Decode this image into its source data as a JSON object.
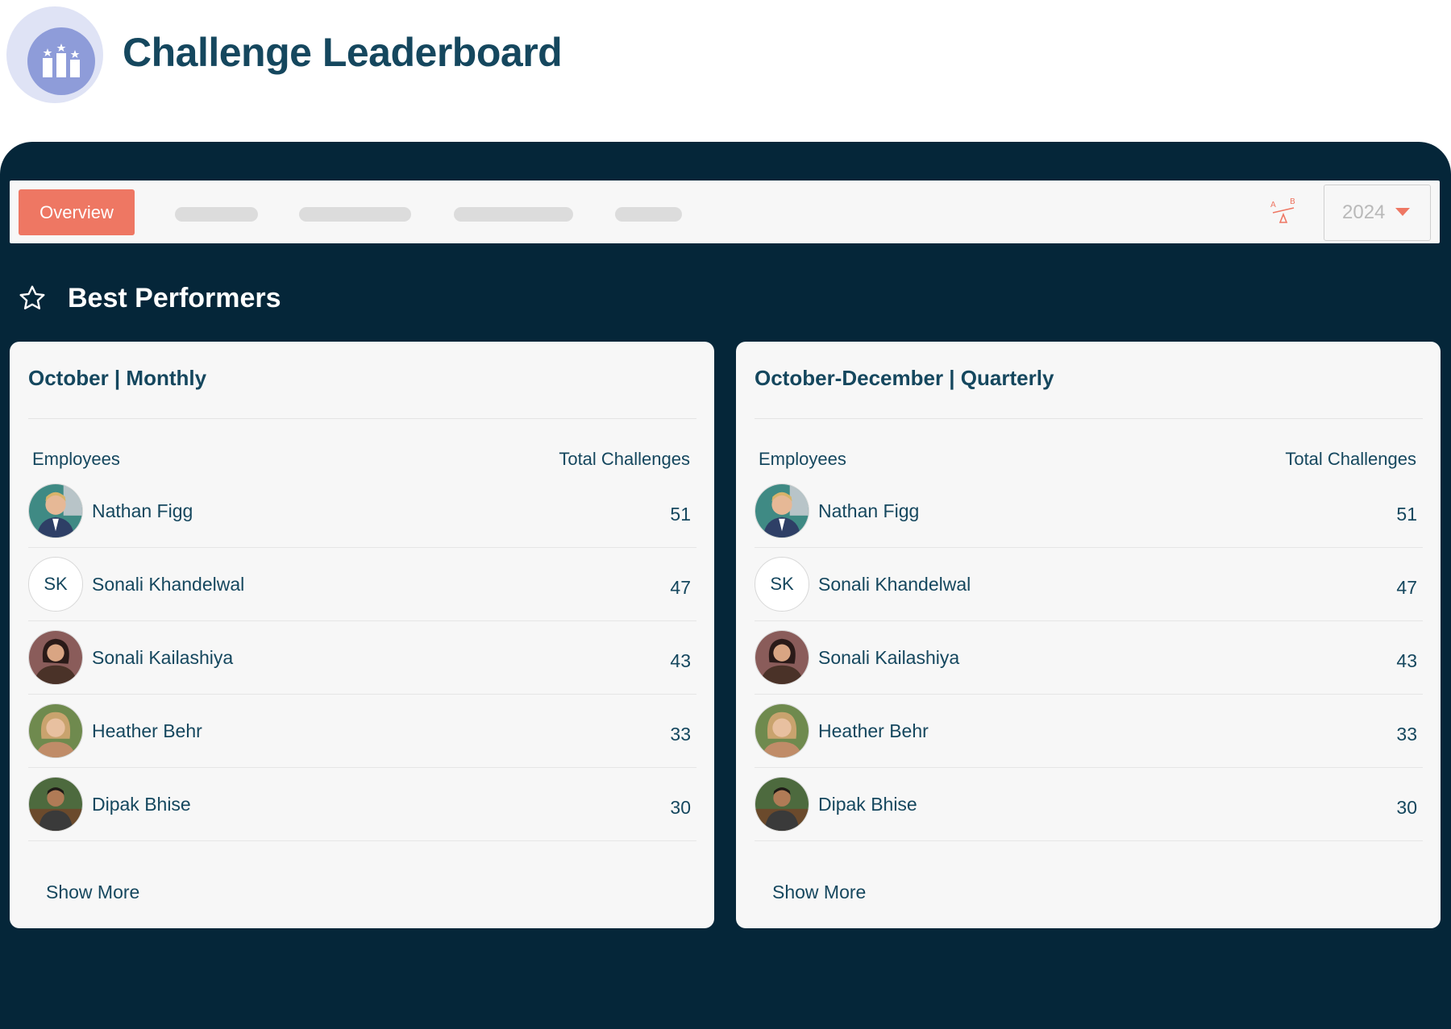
{
  "header": {
    "title": "Challenge Leaderboard",
    "logo_icon": "podium-stars-icon"
  },
  "tabs": {
    "active_label": "Overview",
    "placeholder_tab_count": 4
  },
  "toolbar": {
    "compare_icon": "ab-scale-icon",
    "year_selected": "2024"
  },
  "section": {
    "title": "Best Performers",
    "icon": "star-outline-icon"
  },
  "colors": {
    "accent": "#ee7763",
    "navy": "#052639",
    "text": "#15475e",
    "logo": "#8e9cd9"
  },
  "boards": [
    {
      "title": "October | Monthly",
      "col_employees": "Employees",
      "col_total": "Total Challenges",
      "show_more": "Show More",
      "rows": [
        {
          "name": "Nathan Figg",
          "total": "51",
          "avatar": "photo"
        },
        {
          "name": "Sonali Khandelwal",
          "total": "47",
          "avatar": "initials",
          "initials": "SK"
        },
        {
          "name": "Sonali Kailashiya",
          "total": "43",
          "avatar": "photo"
        },
        {
          "name": "Heather Behr",
          "total": "33",
          "avatar": "photo"
        },
        {
          "name": "Dipak Bhise",
          "total": "30",
          "avatar": "photo"
        }
      ]
    },
    {
      "title": "October-December | Quarterly",
      "col_employees": "Employees",
      "col_total": "Total Challenges",
      "show_more": "Show More",
      "rows": [
        {
          "name": "Nathan Figg",
          "total": "51",
          "avatar": "photo"
        },
        {
          "name": "Sonali Khandelwal",
          "total": "47",
          "avatar": "initials",
          "initials": "SK"
        },
        {
          "name": "Sonali Kailashiya",
          "total": "43",
          "avatar": "photo"
        },
        {
          "name": "Heather Behr",
          "total": "33",
          "avatar": "photo"
        },
        {
          "name": "Dipak Bhise",
          "total": "30",
          "avatar": "photo"
        }
      ]
    }
  ]
}
